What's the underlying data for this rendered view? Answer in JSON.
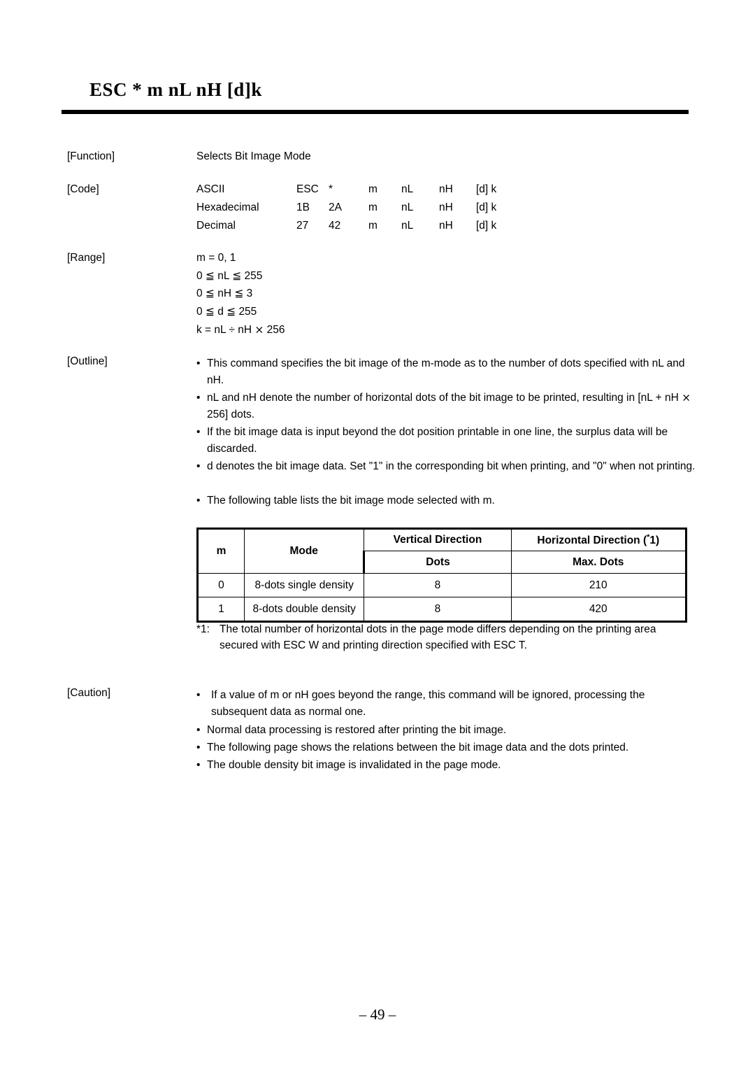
{
  "page": {
    "title": "ESC * m nL nH [d]k",
    "page_number": "– 49 –"
  },
  "sections": {
    "function": {
      "label": "[Function]",
      "text": "Selects Bit Image Mode"
    },
    "code": {
      "label": "[Code]",
      "rows": [
        {
          "name": "ASCII",
          "b1": "ESC",
          "b2": "*",
          "m": "m",
          "nL": "nL",
          "nH": "nH",
          "dk": "[d] k"
        },
        {
          "name": "Hexadecimal",
          "b1": "1B",
          "b2": "2A",
          "m": "m",
          "nL": "nL",
          "nH": "nH",
          "dk": "[d] k"
        },
        {
          "name": "Decimal",
          "b1": "27",
          "b2": "42",
          "m": "m",
          "nL": "nL",
          "nH": "nH",
          "dk": "[d] k"
        }
      ]
    },
    "range": {
      "label": "[Range]",
      "lines": [
        "m = 0, 1",
        "0 ≦ nL ≦ 255",
        "0 ≦ nH ≦ 3",
        "0 ≦ d ≦ 255",
        "k = nL ÷ nH ⨯ 256"
      ]
    },
    "outline": {
      "label": "[Outline]",
      "bullets": [
        "This command specifies the bit image of the m-mode as to the number of dots specified with nL and nH.",
        "nL and nH denote the number of horizontal dots of the bit image to be printed, resulting in [nL + nH ⨯ 256] dots.",
        "If the bit image data is input beyond the dot position printable in one line, the surplus data will be discarded.",
        "d denotes the bit image data.  Set \"1\" in the corresponding bit when printing, and \"0\" when not printing.",
        "The following table lists the bit image mode selected with m."
      ]
    },
    "caution": {
      "label": "[Caution]",
      "bullets": [
        "If a value of m or nH goes beyond the range, this command will be ignored, processing the subsequent data as normal one.",
        "Normal data processing is restored after printing the bit image.",
        "The following page shows the relations between the bit image data and the dots printed.",
        "The double density bit image is invalidated in the page mode."
      ]
    }
  },
  "table": {
    "headers": {
      "m": "m",
      "mode": "Mode",
      "vertical": "Vertical Direction",
      "horizontal": "Horizontal Direction (",
      "horizontal_sup": "*",
      "horizontal_suffix": "1)",
      "dots": "Dots",
      "max_dots": "Max. Dots"
    },
    "rows": [
      {
        "m": "0",
        "mode": "8-dots single density",
        "dots": "8",
        "max_dots": "210"
      },
      {
        "m": "1",
        "mode": "8-dots double density",
        "dots": "8",
        "max_dots": "420"
      }
    ]
  },
  "footnote": {
    "marker": "*1:",
    "text": "The total number of horizontal dots in the page mode differs depending on the printing area secured with ESC W and printing direction specified with ESC T."
  }
}
